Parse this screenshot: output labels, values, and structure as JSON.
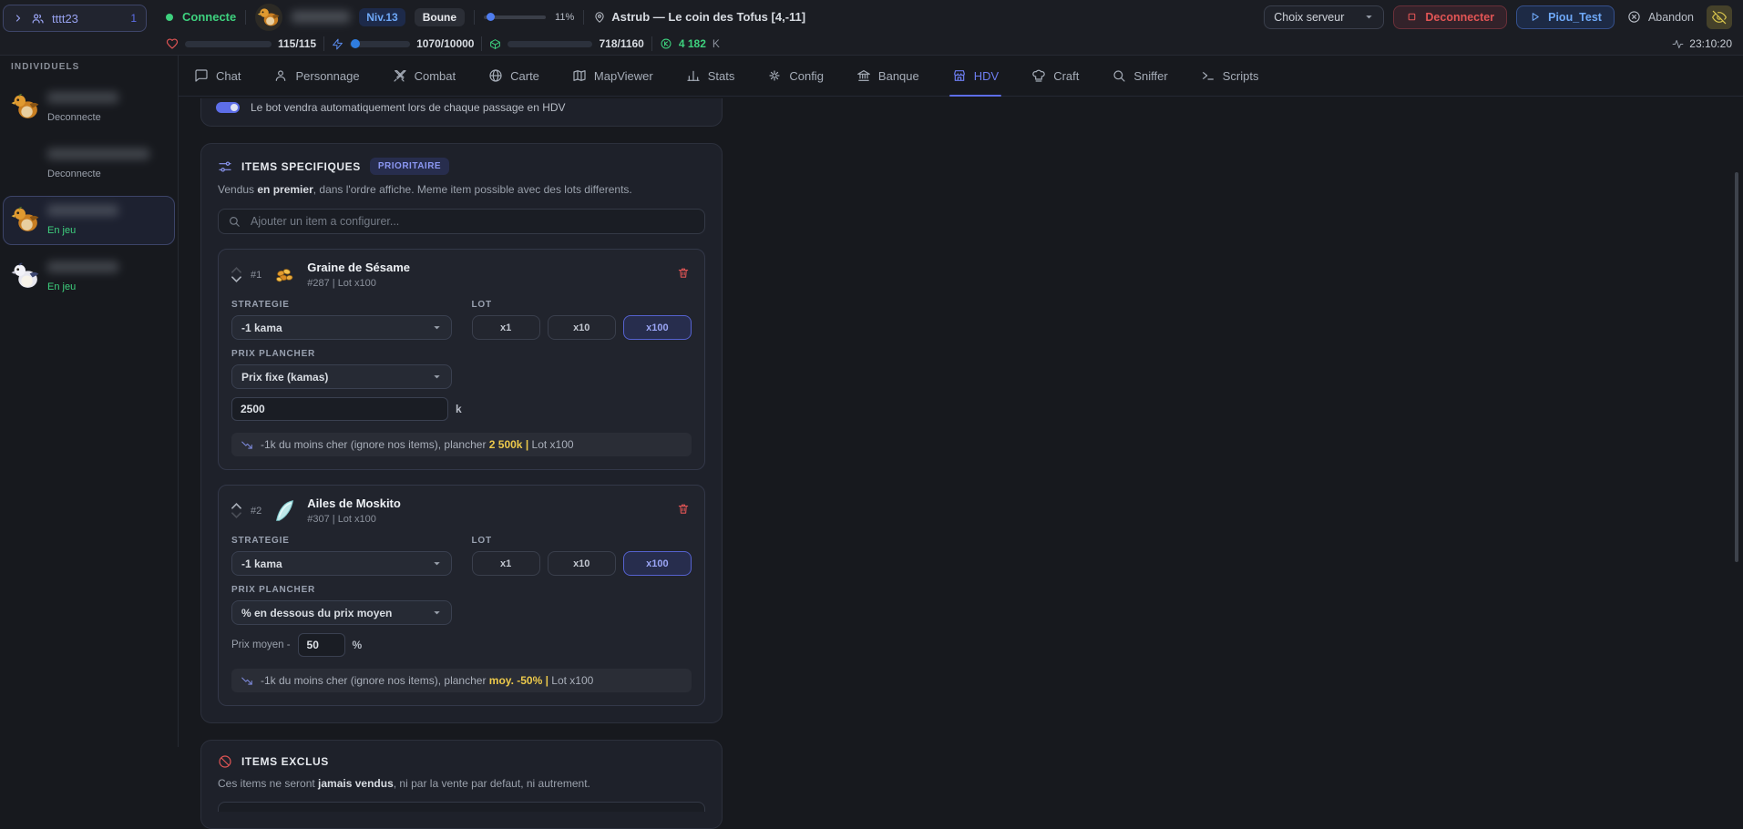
{
  "colors": {
    "accent": "#5d6ee8",
    "green": "#3ed17e",
    "red": "#e25555",
    "yellow": "#ecc94b",
    "blue": "#6ea8f7"
  },
  "icons": {
    "accounts": "users-icon",
    "status": "green-dot",
    "hp": "heart-icon",
    "energy": "zap-icon",
    "xp": "package-icon",
    "kamas": "coin-icon",
    "location": "map-pin-icon",
    "time": "activity-icon",
    "search": "magnifier-icon",
    "specific": "sliders-icon",
    "excluded": "ban-icon",
    "delete": "trash-icon",
    "summary": "trending-down-icon",
    "hide": "eye-off-icon"
  },
  "accounts": {
    "name": "tttt23",
    "count": "1"
  },
  "topbar": {
    "status": "Connecte",
    "level": "Niv.13",
    "mode": "Boune",
    "progress": "11%",
    "location": "Astrub — Le coin des Tofus [4,-11]",
    "server_button": "Choix serveur",
    "disconnect_button": "Deconnecter",
    "piou_button": "Piou_Test",
    "abandon_button": "Abandon",
    "time": "23:10:20"
  },
  "stats": {
    "hp": "115/115",
    "energy": "1070/10000",
    "xp": "718/1160",
    "kamas": "4 182",
    "kamas_unit": "K"
  },
  "tabs": [
    {
      "label": "Chat"
    },
    {
      "label": "Personnage"
    },
    {
      "label": "Combat"
    },
    {
      "label": "Carte"
    },
    {
      "label": "MapViewer"
    },
    {
      "label": "Stats"
    },
    {
      "label": "Config"
    },
    {
      "label": "Banque"
    },
    {
      "label": "HDV"
    },
    {
      "label": "Craft"
    },
    {
      "label": "Sniffer"
    },
    {
      "label": "Scripts"
    }
  ],
  "sidebar": {
    "section": "INDIVIDUELS",
    "characters": [
      {
        "status": "Deconnecte"
      },
      {
        "status": "Deconnecte"
      },
      {
        "status": "En jeu"
      },
      {
        "status": "En jeu"
      }
    ]
  },
  "content": {
    "banner": "Le bot vendra automatiquement lors de chaque passage en HDV",
    "specific": {
      "title": "ITEMS SPECIFIQUES",
      "badge": "PRIORITAIRE",
      "desc_pre": "Vendus ",
      "desc_bold": "en premier",
      "desc_post": ", dans l'ordre affiche. Meme item possible avec des lots differents.",
      "search_placeholder": "Ajouter un item a configurer...",
      "labels": {
        "strategy": "STRATEGIE",
        "lot": "LOT",
        "floor": "PRIX PLANCHER"
      },
      "items": [
        {
          "rank": "#1",
          "name": "Graine de Sésame",
          "meta": "#287 | Lot x100",
          "strategy": "-1 kama",
          "lots": [
            "x1",
            "x10",
            "x100"
          ],
          "lot_selected": "x100",
          "floor_mode": "Prix fixe (kamas)",
          "price": "2500",
          "unit": "k",
          "summary_pre": "-1k du moins cher (ignore nos items), plancher ",
          "summary_val": "2 500k",
          "summary_sep": " | ",
          "summary_post": "Lot x100"
        },
        {
          "rank": "#2",
          "name": "Ailes de Moskito",
          "meta": "#307 | Lot x100",
          "strategy": "-1 kama",
          "lots": [
            "x1",
            "x10",
            "x100"
          ],
          "lot_selected": "x100",
          "floor_mode": "% en dessous du prix moyen",
          "avg_prefix": "Prix moyen -",
          "price": "50",
          "unit": "%",
          "summary_pre": "-1k du moins cher (ignore nos items), plancher ",
          "summary_val": "moy. -50%",
          "summary_sep": " | ",
          "summary_post": "Lot x100"
        }
      ]
    },
    "excluded": {
      "title": "ITEMS EXCLUS",
      "desc_pre": "Ces items ne seront ",
      "desc_bold": "jamais vendus",
      "desc_post": ", ni par la vente par defaut, ni autrement."
    }
  }
}
